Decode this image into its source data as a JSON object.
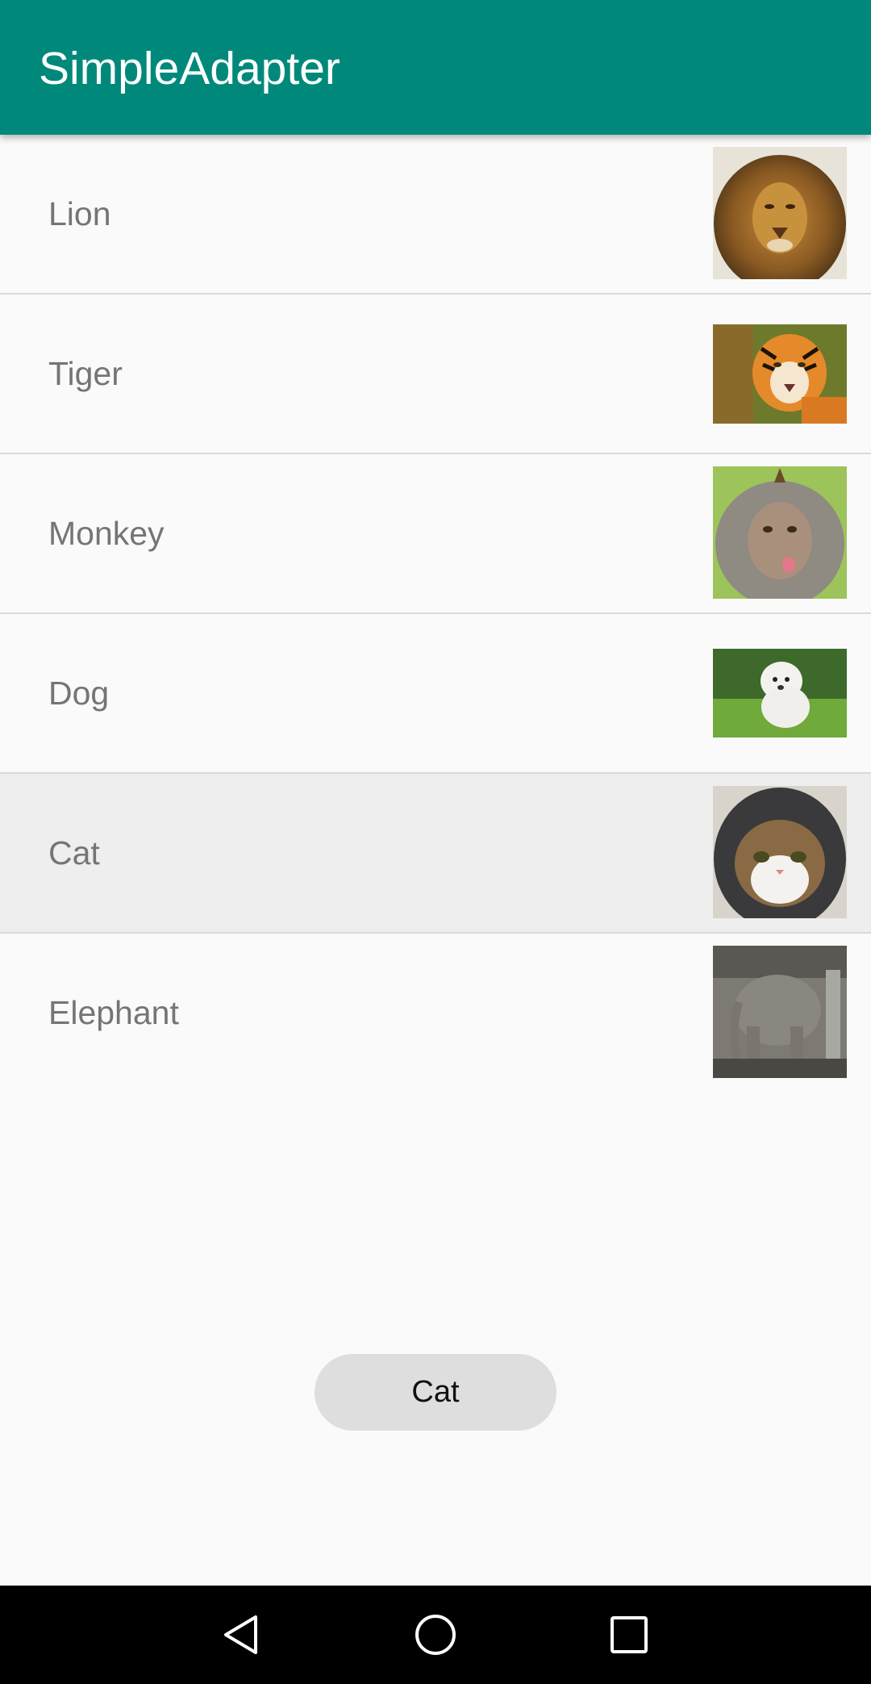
{
  "app_bar": {
    "title": "SimpleAdapter",
    "color": "#00897b"
  },
  "list": {
    "items": [
      {
        "label": "Lion",
        "image_icon": "lion-photo"
      },
      {
        "label": "Tiger",
        "image_icon": "tiger-photo"
      },
      {
        "label": "Monkey",
        "image_icon": "monkey-photo"
      },
      {
        "label": "Dog",
        "image_icon": "dog-photo"
      },
      {
        "label": "Cat",
        "image_icon": "cat-photo",
        "pressed": true
      },
      {
        "label": "Elephant",
        "image_icon": "elephant-photo"
      }
    ]
  },
  "result_button": {
    "label": "Cat"
  },
  "nav_bar": {
    "buttons": [
      {
        "icon": "back-triangle-icon"
      },
      {
        "icon": "home-circle-icon"
      },
      {
        "icon": "recents-square-icon"
      }
    ]
  }
}
